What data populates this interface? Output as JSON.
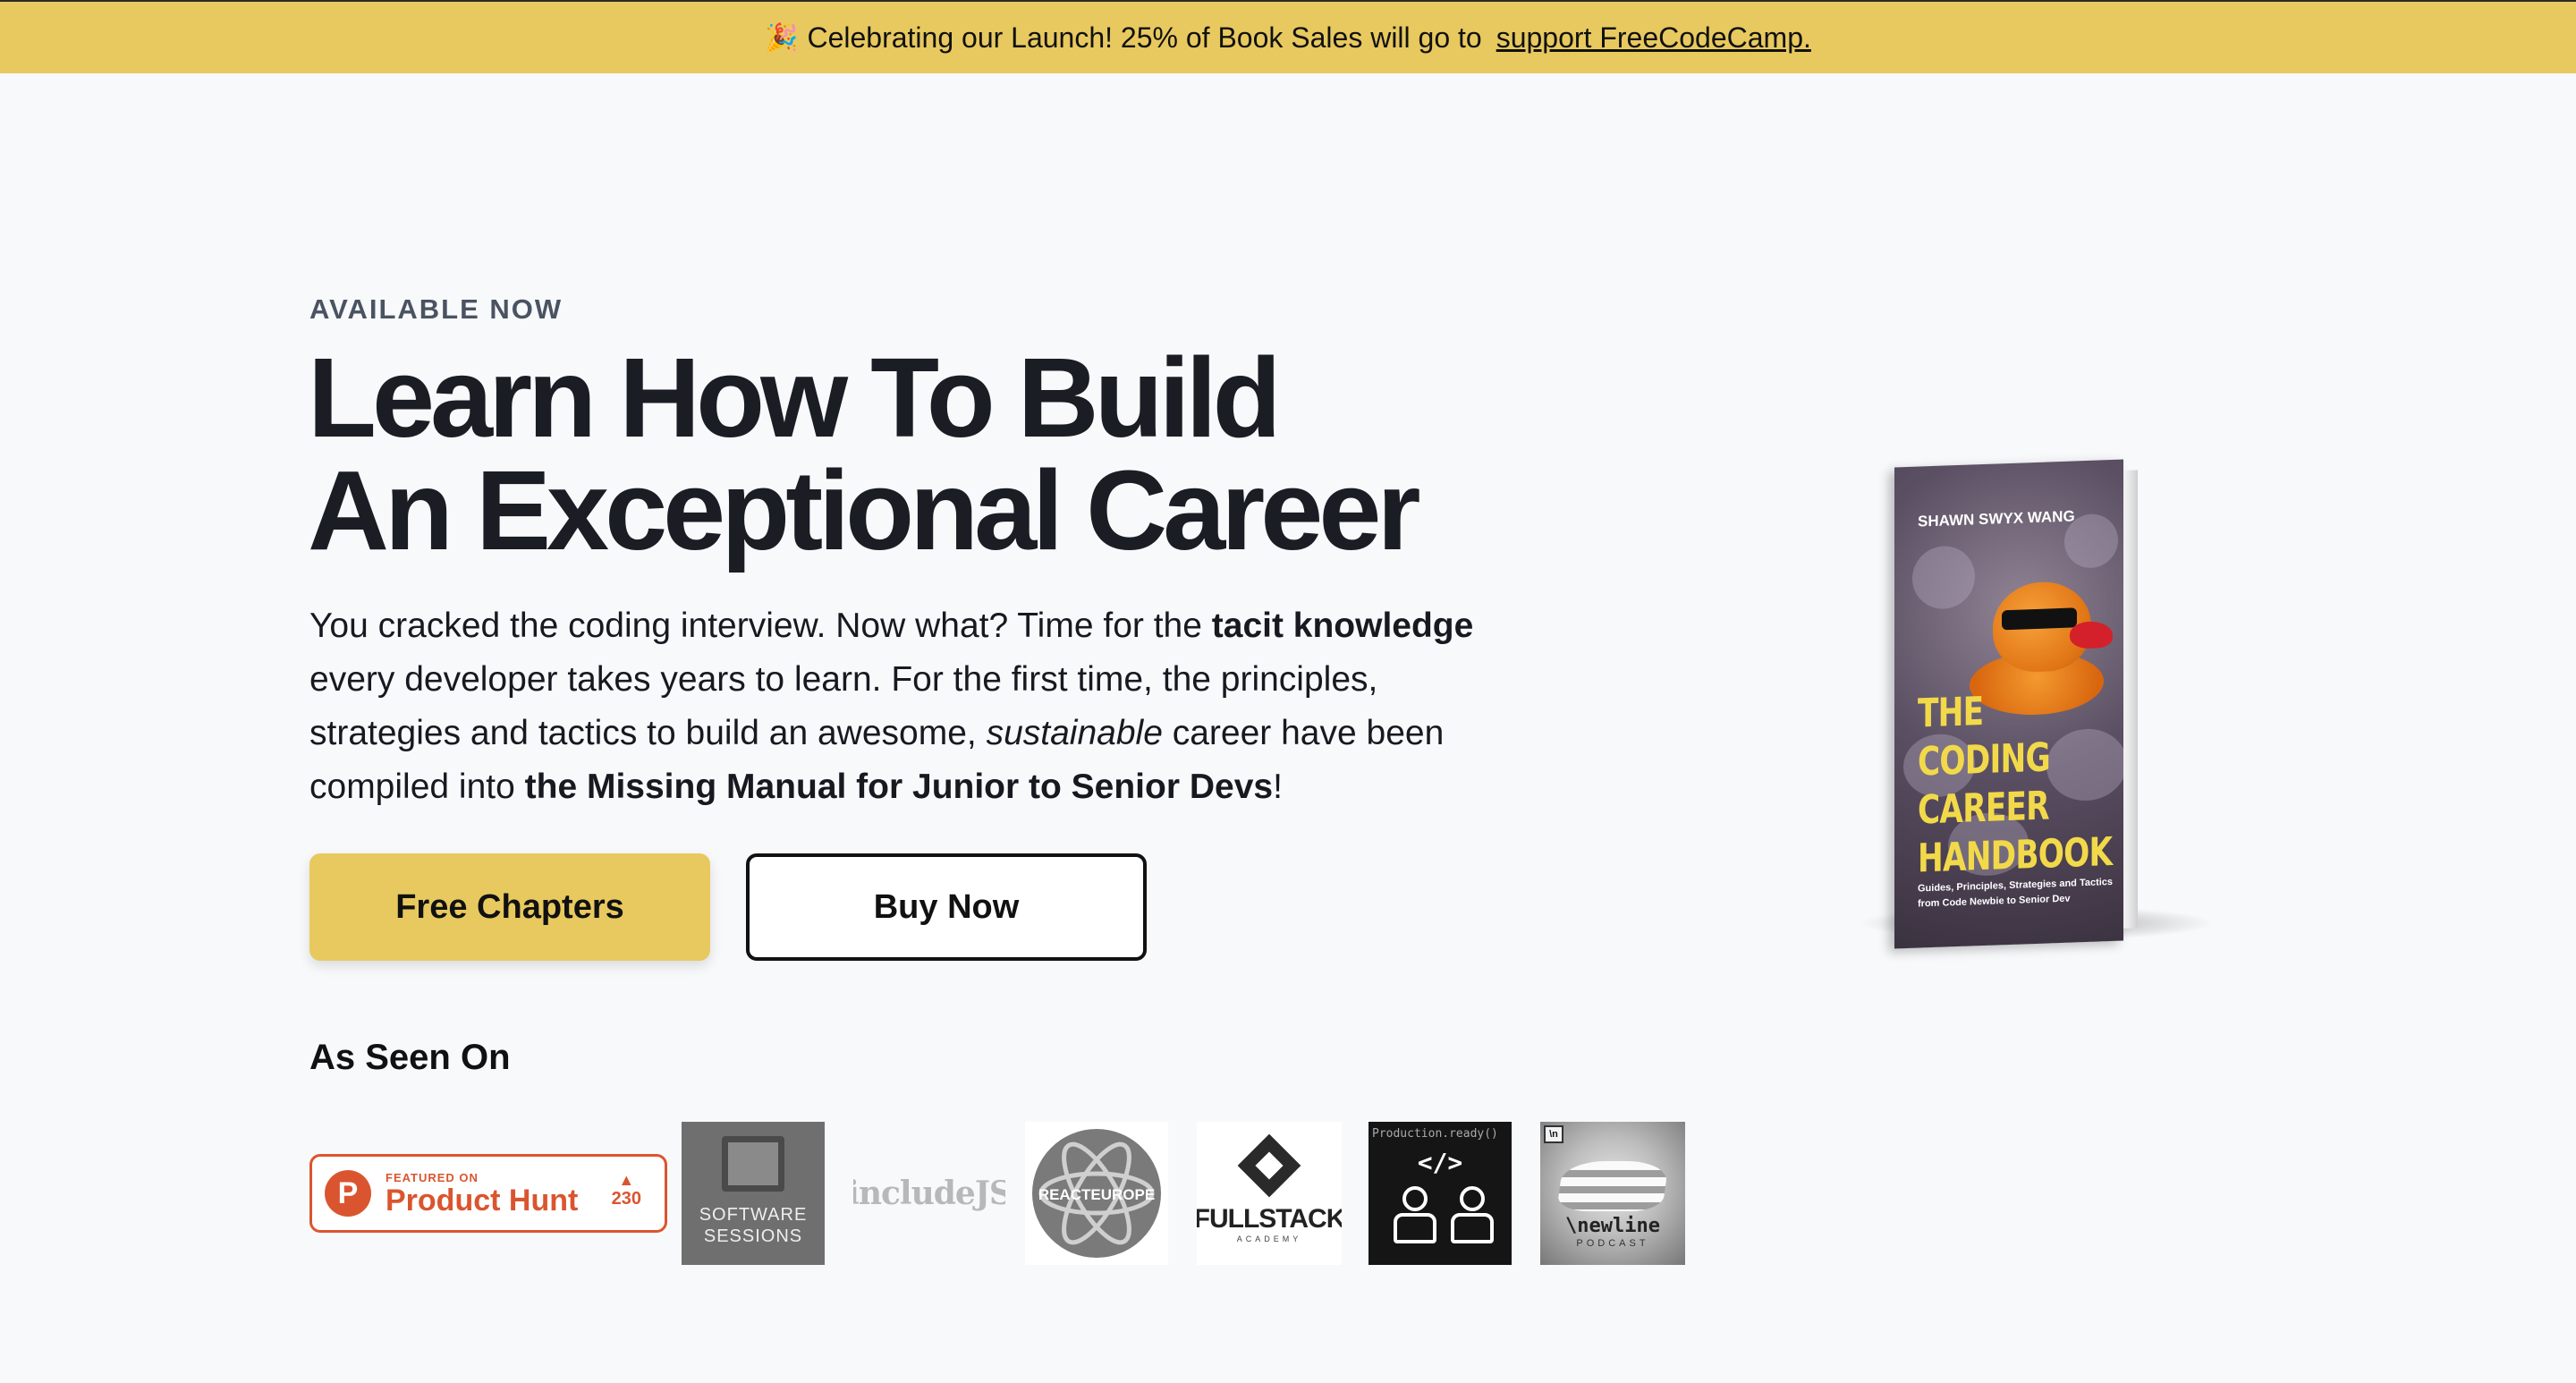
{
  "banner": {
    "emoji": "🎉",
    "text": "Celebrating our Launch! 25% of Book Sales will go to",
    "link": "support FreeCodeCamp."
  },
  "hero": {
    "eyebrow": "AVAILABLE NOW",
    "headline_line1": "Learn How To Build",
    "headline_line2": "An Exceptional Career",
    "desc": {
      "p1": "You cracked the coding interview. Now what? Time for the ",
      "b1": "tacit knowledge",
      "p2": " every developer takes years to learn. For the first time, the principles, strategies and tactics to build an awesome, ",
      "i1": "sustainable",
      "p3": " career have been compiled into ",
      "b2": "the Missing Manual for Junior to Senior Devs",
      "p4": "!"
    },
    "btn_free": "Free Chapters",
    "btn_buy": "Buy Now"
  },
  "seen": {
    "title": "As Seen On",
    "producthunt": {
      "small": "FEATURED ON",
      "big": "Product Hunt",
      "votes": "230",
      "letter": "P"
    },
    "software_sessions": {
      "line1": "SOFTWARE",
      "line2": "SESSIONS"
    },
    "includejs": "includeJS",
    "reacteurope": "REACTEUROPE",
    "fullstack": {
      "name": "FULLSTACK",
      "sub": "ACADEMY"
    },
    "production": {
      "title": "Production.ready()",
      "code": "</>"
    },
    "newline": {
      "name": "\\newline",
      "sub": "PODCAST",
      "corner": "\\n"
    }
  },
  "book": {
    "author": "SHAWN SWYX WANG",
    "title_l1": "THE",
    "title_l2": "CODING",
    "title_l3": "CAREER",
    "title_l4": "HANDBOOK",
    "tagline": "Guides, Principles, Strategies and Tactics from Code Newbie to Senior Dev"
  },
  "colors": {
    "accent": "#e8c95f",
    "producthunt": "#da552f",
    "text": "#1a1d24"
  }
}
